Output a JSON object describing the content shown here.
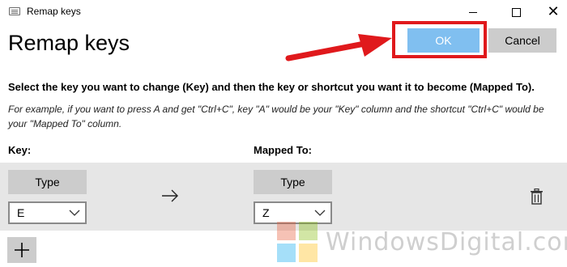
{
  "window": {
    "title": "Remap keys",
    "minimize_icon": "minimize-icon",
    "maximize_icon": "maximize-icon",
    "close_glyph": "✕"
  },
  "header": {
    "heading": "Remap keys",
    "ok_label": "OK",
    "cancel_label": "Cancel"
  },
  "body": {
    "instruction": "Select the key you want to change (Key) and then the key or shortcut you want it to become (Mapped To).",
    "example": "For example, if you want to press A and get \"Ctrl+C\", key \"A\" would be your \"Key\" column and the shortcut \"Ctrl+C\" would be your \"Mapped To\" column."
  },
  "columns": {
    "key_label": "Key:",
    "mapped_label": "Mapped To:"
  },
  "row": {
    "key_type_label": "Type",
    "key_value": "E",
    "mapped_type_label": "Type",
    "mapped_value": "Z"
  },
  "add_label": "+",
  "watermark": {
    "text": "WindowsDigital.com"
  },
  "colors": {
    "accent": "#80bff0",
    "annotation": "#e0191c",
    "row_background": "#e6e6e6",
    "button_gray": "#cccccc"
  }
}
